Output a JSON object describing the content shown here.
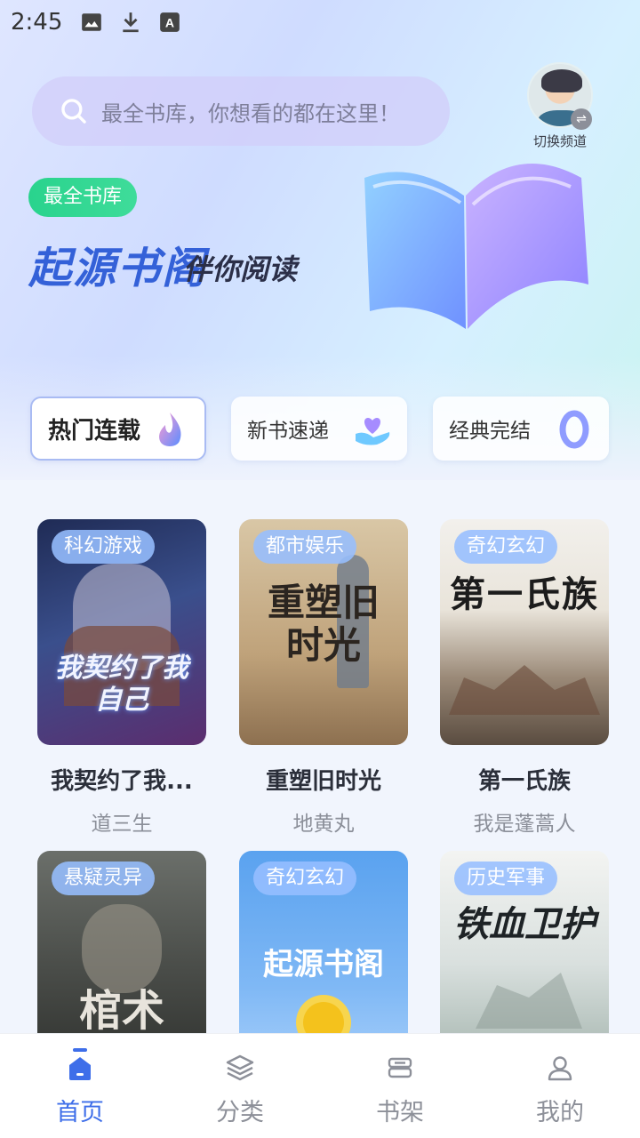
{
  "status_bar": {
    "time": "2:45",
    "icons": [
      "image-icon",
      "download-icon",
      "font-icon"
    ]
  },
  "search": {
    "placeholder": "最全书库，你想看的都在这里！"
  },
  "channel": {
    "label": "切换频道"
  },
  "banner": {
    "badge": "最全书库",
    "title": "起源书阁",
    "subtitle": "伴你阅读"
  },
  "categories": [
    {
      "label": "热门连载",
      "active": true
    },
    {
      "label": "新书速递",
      "active": false
    },
    {
      "label": "经典完结",
      "active": false
    }
  ],
  "books": [
    {
      "tag": "科幻游戏",
      "title": "我契约了我...",
      "author": "道三生",
      "cover_text": "我契约了我自己"
    },
    {
      "tag": "都市娱乐",
      "title": "重塑旧时光",
      "author": "地黄丸",
      "cover_text": "重塑旧时光"
    },
    {
      "tag": "奇幻玄幻",
      "title": "第一氏族",
      "author": "我是蓬蒿人",
      "cover_text": "第一氏族"
    },
    {
      "tag": "悬疑灵异",
      "title": "",
      "author": "",
      "cover_text": "棺术"
    },
    {
      "tag": "奇幻玄幻",
      "title": "",
      "author": "",
      "cover_text": "起源书阁"
    },
    {
      "tag": "历史军事",
      "title": "",
      "author": "",
      "cover_text": "铁血卫护"
    }
  ],
  "nav": [
    {
      "label": "首页",
      "icon": "home-icon",
      "active": true
    },
    {
      "label": "分类",
      "icon": "layers-icon",
      "active": false
    },
    {
      "label": "书架",
      "icon": "bookshelf-icon",
      "active": false
    },
    {
      "label": "我的",
      "icon": "user-icon",
      "active": false
    }
  ],
  "colors": {
    "accent": "#3e6ee9",
    "badge": "#29d38d",
    "title_blue": "#3461d8"
  }
}
